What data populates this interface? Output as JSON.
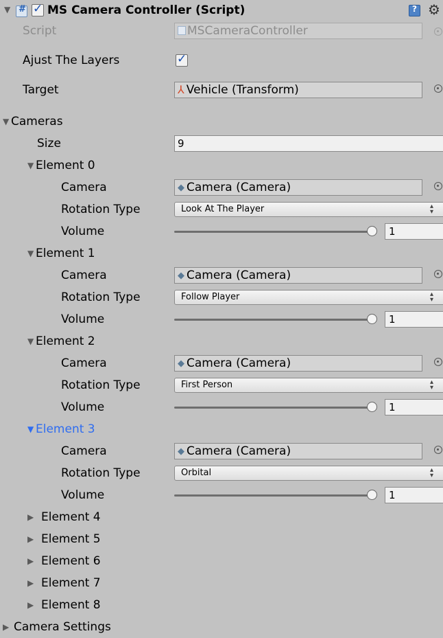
{
  "header": {
    "title": "MS Camera Controller (Script)",
    "enabled": true
  },
  "script": {
    "label": "Script",
    "value": "MSCameraController"
  },
  "ajust_layers": {
    "label": "Ajust The Layers",
    "checked": true
  },
  "target": {
    "label": "Target",
    "value": "Vehicle (Transform)"
  },
  "cameras": {
    "label": "Cameras",
    "size_label": "Size",
    "size": "9",
    "field_labels": {
      "camera": "Camera",
      "rotation": "Rotation Type",
      "volume": "Volume"
    },
    "elements": [
      {
        "label": "Element 0",
        "camera": "Camera (Camera)",
        "rotation": "Look At The Player",
        "volume": "1"
      },
      {
        "label": "Element 1",
        "camera": "Camera (Camera)",
        "rotation": "Follow Player",
        "volume": "1"
      },
      {
        "label": "Element 2",
        "camera": "Camera (Camera)",
        "rotation": "First Person",
        "volume": "1"
      },
      {
        "label": "Element 3",
        "camera": "Camera (Camera)",
        "rotation": "Orbital",
        "volume": "1"
      }
    ],
    "collapsed": [
      "Element 4",
      "Element 5",
      "Element 6",
      "Element 7",
      "Element 8"
    ]
  },
  "camera_settings": {
    "label": "Camera Settings"
  },
  "colors": {
    "background": "#c2c2c2",
    "selected_text": "#2f6df0"
  }
}
